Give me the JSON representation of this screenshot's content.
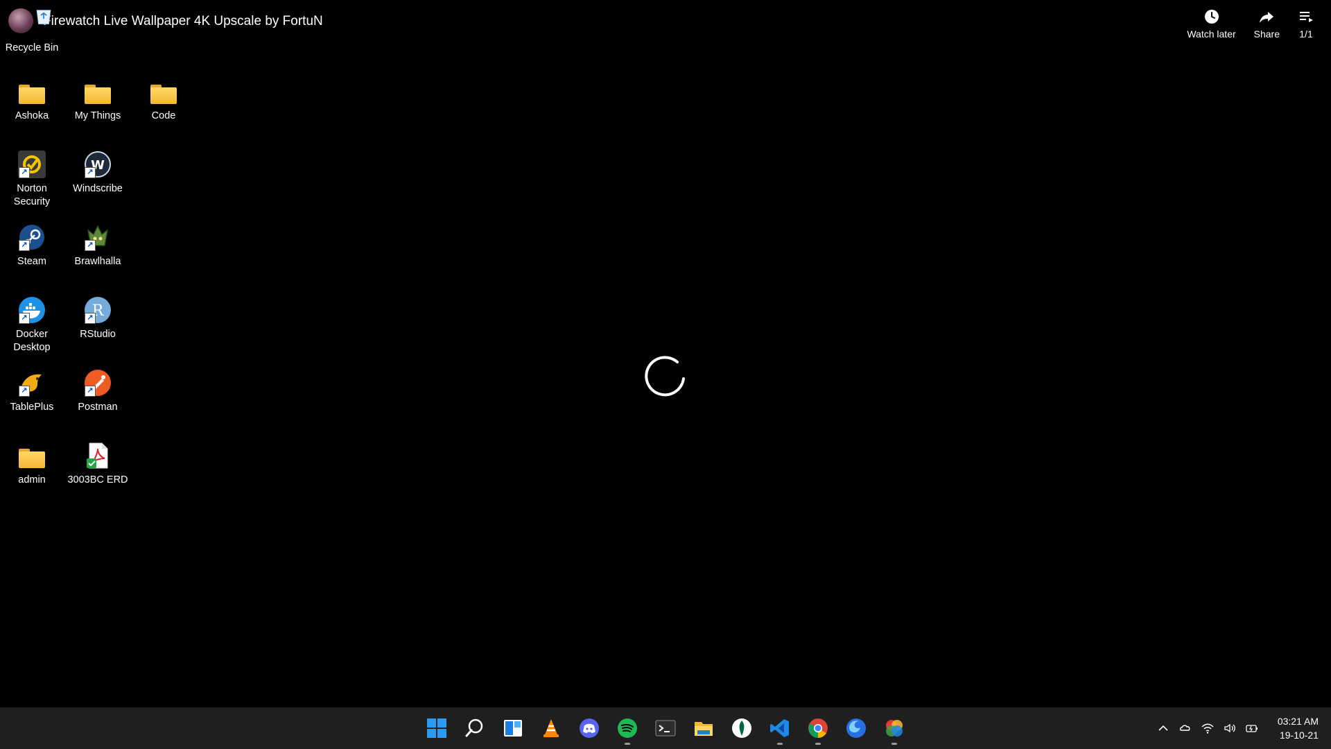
{
  "video": {
    "title": "Firewatch Live Wallpaper 4K Upscale by FortuN",
    "actions": [
      {
        "label": "Watch later",
        "icon": "clock-icon"
      },
      {
        "label": "Share",
        "icon": "share-icon"
      },
      {
        "label": "1/1",
        "icon": "playlist-icon"
      }
    ]
  },
  "desktop": {
    "icons": [
      {
        "label": "Recycle Bin",
        "icon": "recycle-bin-icon"
      },
      {
        "label": "Ashoka",
        "icon": "folder-icon"
      },
      {
        "label": "My Things",
        "icon": "folder-icon"
      },
      {
        "label": "Code",
        "icon": "folder-icon"
      },
      {
        "label": "Norton Security",
        "icon": "norton-icon"
      },
      {
        "label": "Windscribe",
        "icon": "windscribe-icon"
      },
      {
        "label": "Steam",
        "icon": "steam-icon"
      },
      {
        "label": "Brawlhalla",
        "icon": "brawlhalla-icon"
      },
      {
        "label": "Docker Desktop",
        "icon": "docker-icon"
      },
      {
        "label": "RStudio",
        "icon": "rstudio-icon"
      },
      {
        "label": "TablePlus",
        "icon": "tableplus-icon"
      },
      {
        "label": "Postman",
        "icon": "postman-icon"
      },
      {
        "label": "admin",
        "icon": "folder-icon"
      },
      {
        "label": "3003BC ERD",
        "icon": "pdf-icon"
      }
    ]
  },
  "taskbar": {
    "apps": [
      {
        "name": "start-icon",
        "running": false
      },
      {
        "name": "search-icon",
        "running": false
      },
      {
        "name": "widgets-icon",
        "running": false
      },
      {
        "name": "vlc-icon",
        "running": false
      },
      {
        "name": "discord-icon",
        "running": false
      },
      {
        "name": "spotify-icon",
        "running": true
      },
      {
        "name": "terminal-icon",
        "running": false
      },
      {
        "name": "file-explorer-icon",
        "running": false
      },
      {
        "name": "mongodb-compass-icon",
        "running": false
      },
      {
        "name": "vscode-icon",
        "running": true
      },
      {
        "name": "chrome-icon",
        "running": true
      },
      {
        "name": "firefox-icon",
        "running": false
      },
      {
        "name": "color-app-icon",
        "running": true
      }
    ],
    "tray": [
      "chevron-up-icon",
      "cloud-icon",
      "wifi-icon",
      "speaker-icon",
      "battery-icon"
    ],
    "clock": {
      "time": "03:21 AM",
      "date": "19-10-21"
    }
  },
  "colors": {
    "background": "#000000",
    "taskbar": "#1f1f1f",
    "accent": "#0078d4"
  }
}
